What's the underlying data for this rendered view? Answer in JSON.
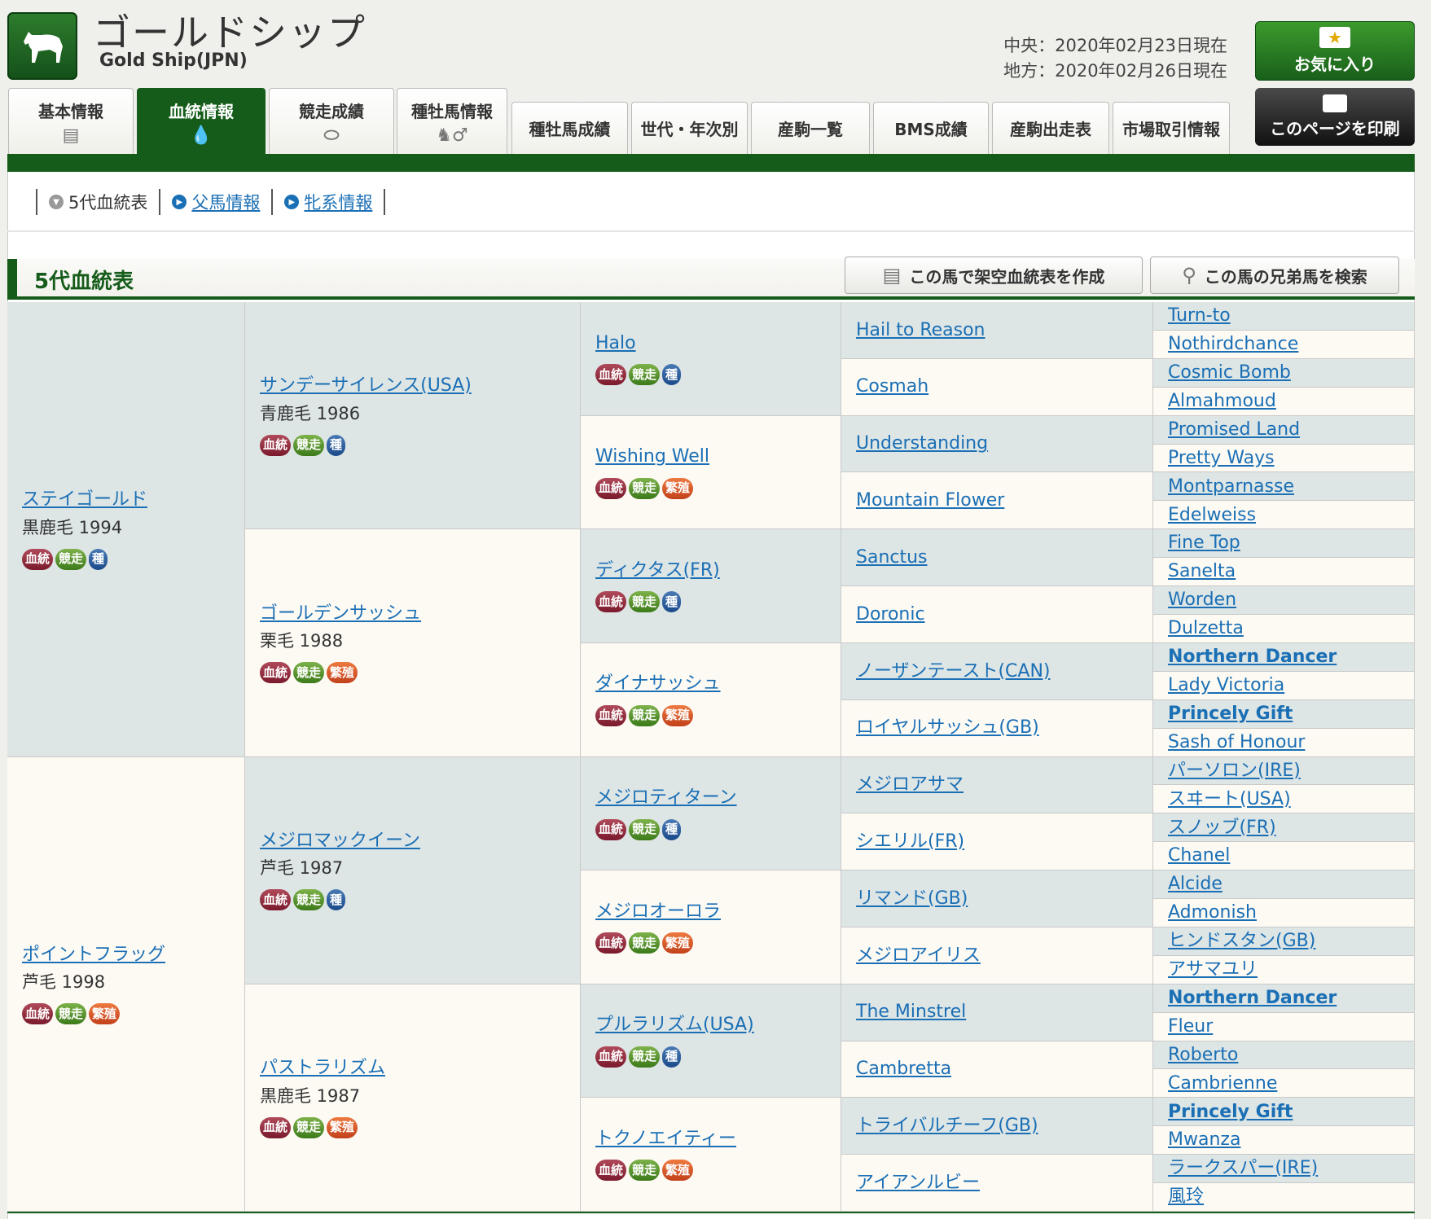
{
  "header": {
    "title_jp": "ゴールドシップ",
    "title_en": "Gold Ship(JPN)",
    "date_central": "中央：2020年02月23日現在",
    "date_local": "地方：2020年02月26日現在",
    "favorite_label": "お気に入り",
    "print_label": "このページを印刷"
  },
  "tabs": [
    {
      "label": "基本情報",
      "icon": "document-icon",
      "active": false
    },
    {
      "label": "血統情報",
      "icon": "drop-icon",
      "active": true
    },
    {
      "label": "競走成績",
      "icon": "track-icon",
      "active": false
    },
    {
      "label": "種牡馬情報",
      "icon": "horse-male-icon",
      "active": false
    },
    {
      "label": "種牡馬成績",
      "active": false
    },
    {
      "label": "世代・年次別",
      "active": false
    },
    {
      "label": "産駒一覧",
      "active": false
    },
    {
      "label": "BMS成績",
      "active": false
    },
    {
      "label": "産駒出走表",
      "active": false
    },
    {
      "label": "市場取引情報",
      "active": false
    }
  ],
  "subnav": [
    {
      "label": "5代血統表",
      "link": false
    },
    {
      "label": "父馬情報",
      "link": true
    },
    {
      "label": "牝系情報",
      "link": true
    }
  ],
  "section": {
    "title": "5代血統表",
    "create_button": "この馬で架空血統表を作成",
    "search_button": "この馬の兄弟馬を検索"
  },
  "badges": {
    "blood": "血統",
    "race": "競走",
    "stud": "種",
    "breed": "繁殖"
  },
  "pedigree": {
    "gen1": [
      {
        "name": "ステイゴールド",
        "info": "黒鹿毛 1994",
        "badges": [
          "blood",
          "race",
          "stud"
        ]
      },
      {
        "name": "ポイントフラッグ",
        "info": "芦毛 1998",
        "badges": [
          "blood",
          "race",
          "breed"
        ]
      }
    ],
    "gen2": [
      {
        "name": "サンデーサイレンス(USA)",
        "info": "青鹿毛 1986",
        "badges": [
          "blood",
          "race",
          "stud"
        ]
      },
      {
        "name": "ゴールデンサッシュ",
        "info": "栗毛 1988",
        "badges": [
          "blood",
          "race",
          "breed"
        ]
      },
      {
        "name": "メジロマックイーン",
        "info": "芦毛 1987",
        "badges": [
          "blood",
          "race",
          "stud"
        ]
      },
      {
        "name": "パストラリズム",
        "info": "黒鹿毛 1987",
        "badges": [
          "blood",
          "race",
          "breed"
        ]
      }
    ],
    "gen3": [
      {
        "name": "Halo",
        "badges": [
          "blood",
          "race",
          "stud"
        ]
      },
      {
        "name": "Wishing Well",
        "badges": [
          "blood",
          "race",
          "breed"
        ]
      },
      {
        "name": "ディクタス(FR)",
        "badges": [
          "blood",
          "race",
          "stud"
        ]
      },
      {
        "name": "ダイナサッシュ",
        "badges": [
          "blood",
          "race",
          "breed"
        ]
      },
      {
        "name": "メジロティターン",
        "badges": [
          "blood",
          "race",
          "stud"
        ]
      },
      {
        "name": "メジロオーロラ",
        "badges": [
          "blood",
          "race",
          "breed"
        ]
      },
      {
        "name": "プルラリズム(USA)",
        "badges": [
          "blood",
          "race",
          "stud"
        ]
      },
      {
        "name": "トクノエイティー",
        "badges": [
          "blood",
          "race",
          "breed"
        ]
      }
    ],
    "gen4": [
      "Hail to Reason",
      "Cosmah",
      "Understanding",
      "Mountain Flower",
      "Sanctus",
      "Doronic",
      "ノーザンテースト(CAN)",
      "ロイヤルサッシュ(GB)",
      "メジロアサマ",
      "シエリル(FR)",
      "リマンド(GB)",
      "メジロアイリス",
      "The Minstrel",
      "Cambretta",
      "トライバルチーフ(GB)",
      "アイアンルビー"
    ],
    "gen5": [
      {
        "name": "Turn-to",
        "bold": false
      },
      {
        "name": "Nothirdchance",
        "bold": false
      },
      {
        "name": "Cosmic Bomb",
        "bold": false
      },
      {
        "name": "Almahmoud",
        "bold": false
      },
      {
        "name": "Promised Land",
        "bold": false
      },
      {
        "name": "Pretty Ways",
        "bold": false
      },
      {
        "name": "Montparnasse",
        "bold": false
      },
      {
        "name": "Edelweiss",
        "bold": false
      },
      {
        "name": "Fine Top",
        "bold": false
      },
      {
        "name": "Sanelta",
        "bold": false
      },
      {
        "name": "Worden",
        "bold": false
      },
      {
        "name": "Dulzetta",
        "bold": false
      },
      {
        "name": "Northern Dancer",
        "bold": true
      },
      {
        "name": "Lady Victoria",
        "bold": false
      },
      {
        "name": "Princely Gift",
        "bold": true
      },
      {
        "name": "Sash of Honour",
        "bold": false
      },
      {
        "name": "パーソロン(IRE)",
        "bold": false
      },
      {
        "name": "スヰート(USA)",
        "bold": false
      },
      {
        "name": "スノッブ(FR)",
        "bold": false
      },
      {
        "name": "Chanel",
        "bold": false
      },
      {
        "name": "Alcide",
        "bold": false
      },
      {
        "name": "Admonish",
        "bold": false
      },
      {
        "name": "ヒンドスタン(GB)",
        "bold": false
      },
      {
        "name": "アサマユリ",
        "bold": false
      },
      {
        "name": "Northern Dancer",
        "bold": true
      },
      {
        "name": "Fleur",
        "bold": false
      },
      {
        "name": "Roberto",
        "bold": false
      },
      {
        "name": "Cambrienne",
        "bold": false
      },
      {
        "name": "Princely Gift",
        "bold": true
      },
      {
        "name": "Mwanza",
        "bold": false
      },
      {
        "name": "ラークスパー(IRE)",
        "bold": false
      },
      {
        "name": "風玲",
        "bold": false
      }
    ]
  }
}
